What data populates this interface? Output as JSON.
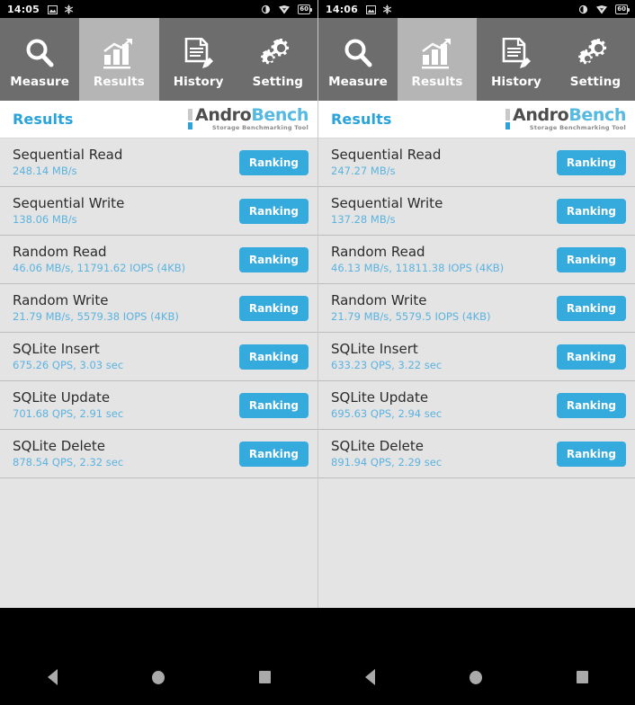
{
  "panes": [
    {
      "statusbar": {
        "time": "14:05",
        "left_icons": [
          "image-icon",
          "snowflake-icon"
        ],
        "right_icons": [
          "brightness-icon",
          "wifi-icon"
        ],
        "battery_label": "60"
      },
      "tabs": [
        {
          "label": "Measure",
          "icon": "magnifier-icon",
          "active": false
        },
        {
          "label": "Results",
          "icon": "bar-chart-icon",
          "active": true
        },
        {
          "label": "History",
          "icon": "document-pencil-icon",
          "active": false
        },
        {
          "label": "Setting",
          "icon": "gears-icon",
          "active": false
        }
      ],
      "header": {
        "title": "Results",
        "logo_andro": "Andro",
        "logo_bench": "Bench",
        "logo_sub": "Storage Benchmarking Tool"
      },
      "rows": [
        {
          "title": "Sequential Read",
          "value": "248.14 MB/s",
          "button": "Ranking"
        },
        {
          "title": "Sequential Write",
          "value": "138.06 MB/s",
          "button": "Ranking"
        },
        {
          "title": "Random Read",
          "value": "46.06 MB/s, 11791.62 IOPS (4KB)",
          "button": "Ranking"
        },
        {
          "title": "Random Write",
          "value": "21.79 MB/s, 5579.38 IOPS (4KB)",
          "button": "Ranking"
        },
        {
          "title": "SQLite Insert",
          "value": "675.26 QPS, 3.03 sec",
          "button": "Ranking"
        },
        {
          "title": "SQLite Update",
          "value": "701.68 QPS, 2.91 sec",
          "button": "Ranking"
        },
        {
          "title": "SQLite Delete",
          "value": "878.54 QPS, 2.32 sec",
          "button": "Ranking"
        }
      ],
      "navbar": [
        {
          "icon": "back-triangle-icon",
          "name": "back"
        },
        {
          "icon": "home-circle-icon",
          "name": "home"
        },
        {
          "icon": "recents-square-icon",
          "name": "recents"
        }
      ]
    },
    {
      "statusbar": {
        "time": "14:06",
        "left_icons": [
          "image-icon",
          "snowflake-icon"
        ],
        "right_icons": [
          "brightness-icon",
          "wifi-icon"
        ],
        "battery_label": "60"
      },
      "tabs": [
        {
          "label": "Measure",
          "icon": "magnifier-icon",
          "active": false
        },
        {
          "label": "Results",
          "icon": "bar-chart-icon",
          "active": true
        },
        {
          "label": "History",
          "icon": "document-pencil-icon",
          "active": false
        },
        {
          "label": "Setting",
          "icon": "gears-icon",
          "active": false
        }
      ],
      "header": {
        "title": "Results",
        "logo_andro": "Andro",
        "logo_bench": "Bench",
        "logo_sub": "Storage Benchmarking Tool"
      },
      "rows": [
        {
          "title": "Sequential Read",
          "value": "247.27 MB/s",
          "button": "Ranking"
        },
        {
          "title": "Sequential Write",
          "value": "137.28 MB/s",
          "button": "Ranking"
        },
        {
          "title": "Random Read",
          "value": "46.13 MB/s, 11811.38 IOPS (4KB)",
          "button": "Ranking"
        },
        {
          "title": "Random Write",
          "value": "21.79 MB/s, 5579.5 IOPS (4KB)",
          "button": "Ranking"
        },
        {
          "title": "SQLite Insert",
          "value": "633.23 QPS, 3.22 sec",
          "button": "Ranking"
        },
        {
          "title": "SQLite Update",
          "value": "695.63 QPS, 2.94 sec",
          "button": "Ranking"
        },
        {
          "title": "SQLite Delete",
          "value": "891.94 QPS, 2.29 sec",
          "button": "Ranking"
        }
      ],
      "navbar": [
        {
          "icon": "back-triangle-icon",
          "name": "back"
        },
        {
          "icon": "home-circle-icon",
          "name": "home"
        },
        {
          "icon": "recents-square-icon",
          "name": "recents"
        }
      ]
    }
  ],
  "colors": {
    "accent": "#29a3d9",
    "button": "#35aadd",
    "value_text": "#5bb3e0",
    "tabbar": "#6d6d6d",
    "tab_active": "#b5b5b5",
    "row_bg": "#e4e4e4",
    "statusbar": "#000000"
  }
}
